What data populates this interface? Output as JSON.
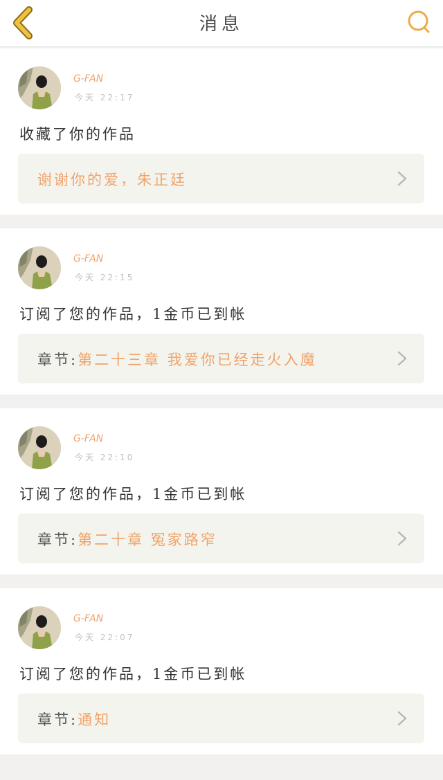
{
  "nav": {
    "title": "消息",
    "back_icon": "chevron-left-icon",
    "search_icon": "search-icon",
    "accent_color": "#f0a94a"
  },
  "colors": {
    "accent_orange": "#f0a36a",
    "text_dark": "#333333",
    "time_gray": "#c0c0c0",
    "card_bg": "#ffffff",
    "box_bg": "#f4f4ee"
  },
  "messages": [
    {
      "username": "G-FAN",
      "time": "今天 22:17",
      "action": "收藏了你的作品",
      "chapter_prefix": "",
      "work_title": "谢谢你的爱，朱正廷"
    },
    {
      "username": "G-FAN",
      "time": "今天 22:15",
      "action": "订阅了您的作品，1金币已到帐",
      "chapter_prefix": "章节:",
      "work_title": "第二十三章 我爱你已经走火入魔"
    },
    {
      "username": "G-FAN",
      "time": "今天 22:10",
      "action": "订阅了您的作品，1金币已到帐",
      "chapter_prefix": "章节:",
      "work_title": "第二十章 冤家路窄"
    },
    {
      "username": "G-FAN",
      "time": "今天 22:07",
      "action": "订阅了您的作品，1金币已到帐",
      "chapter_prefix": "章节:",
      "work_title": "通知"
    }
  ]
}
